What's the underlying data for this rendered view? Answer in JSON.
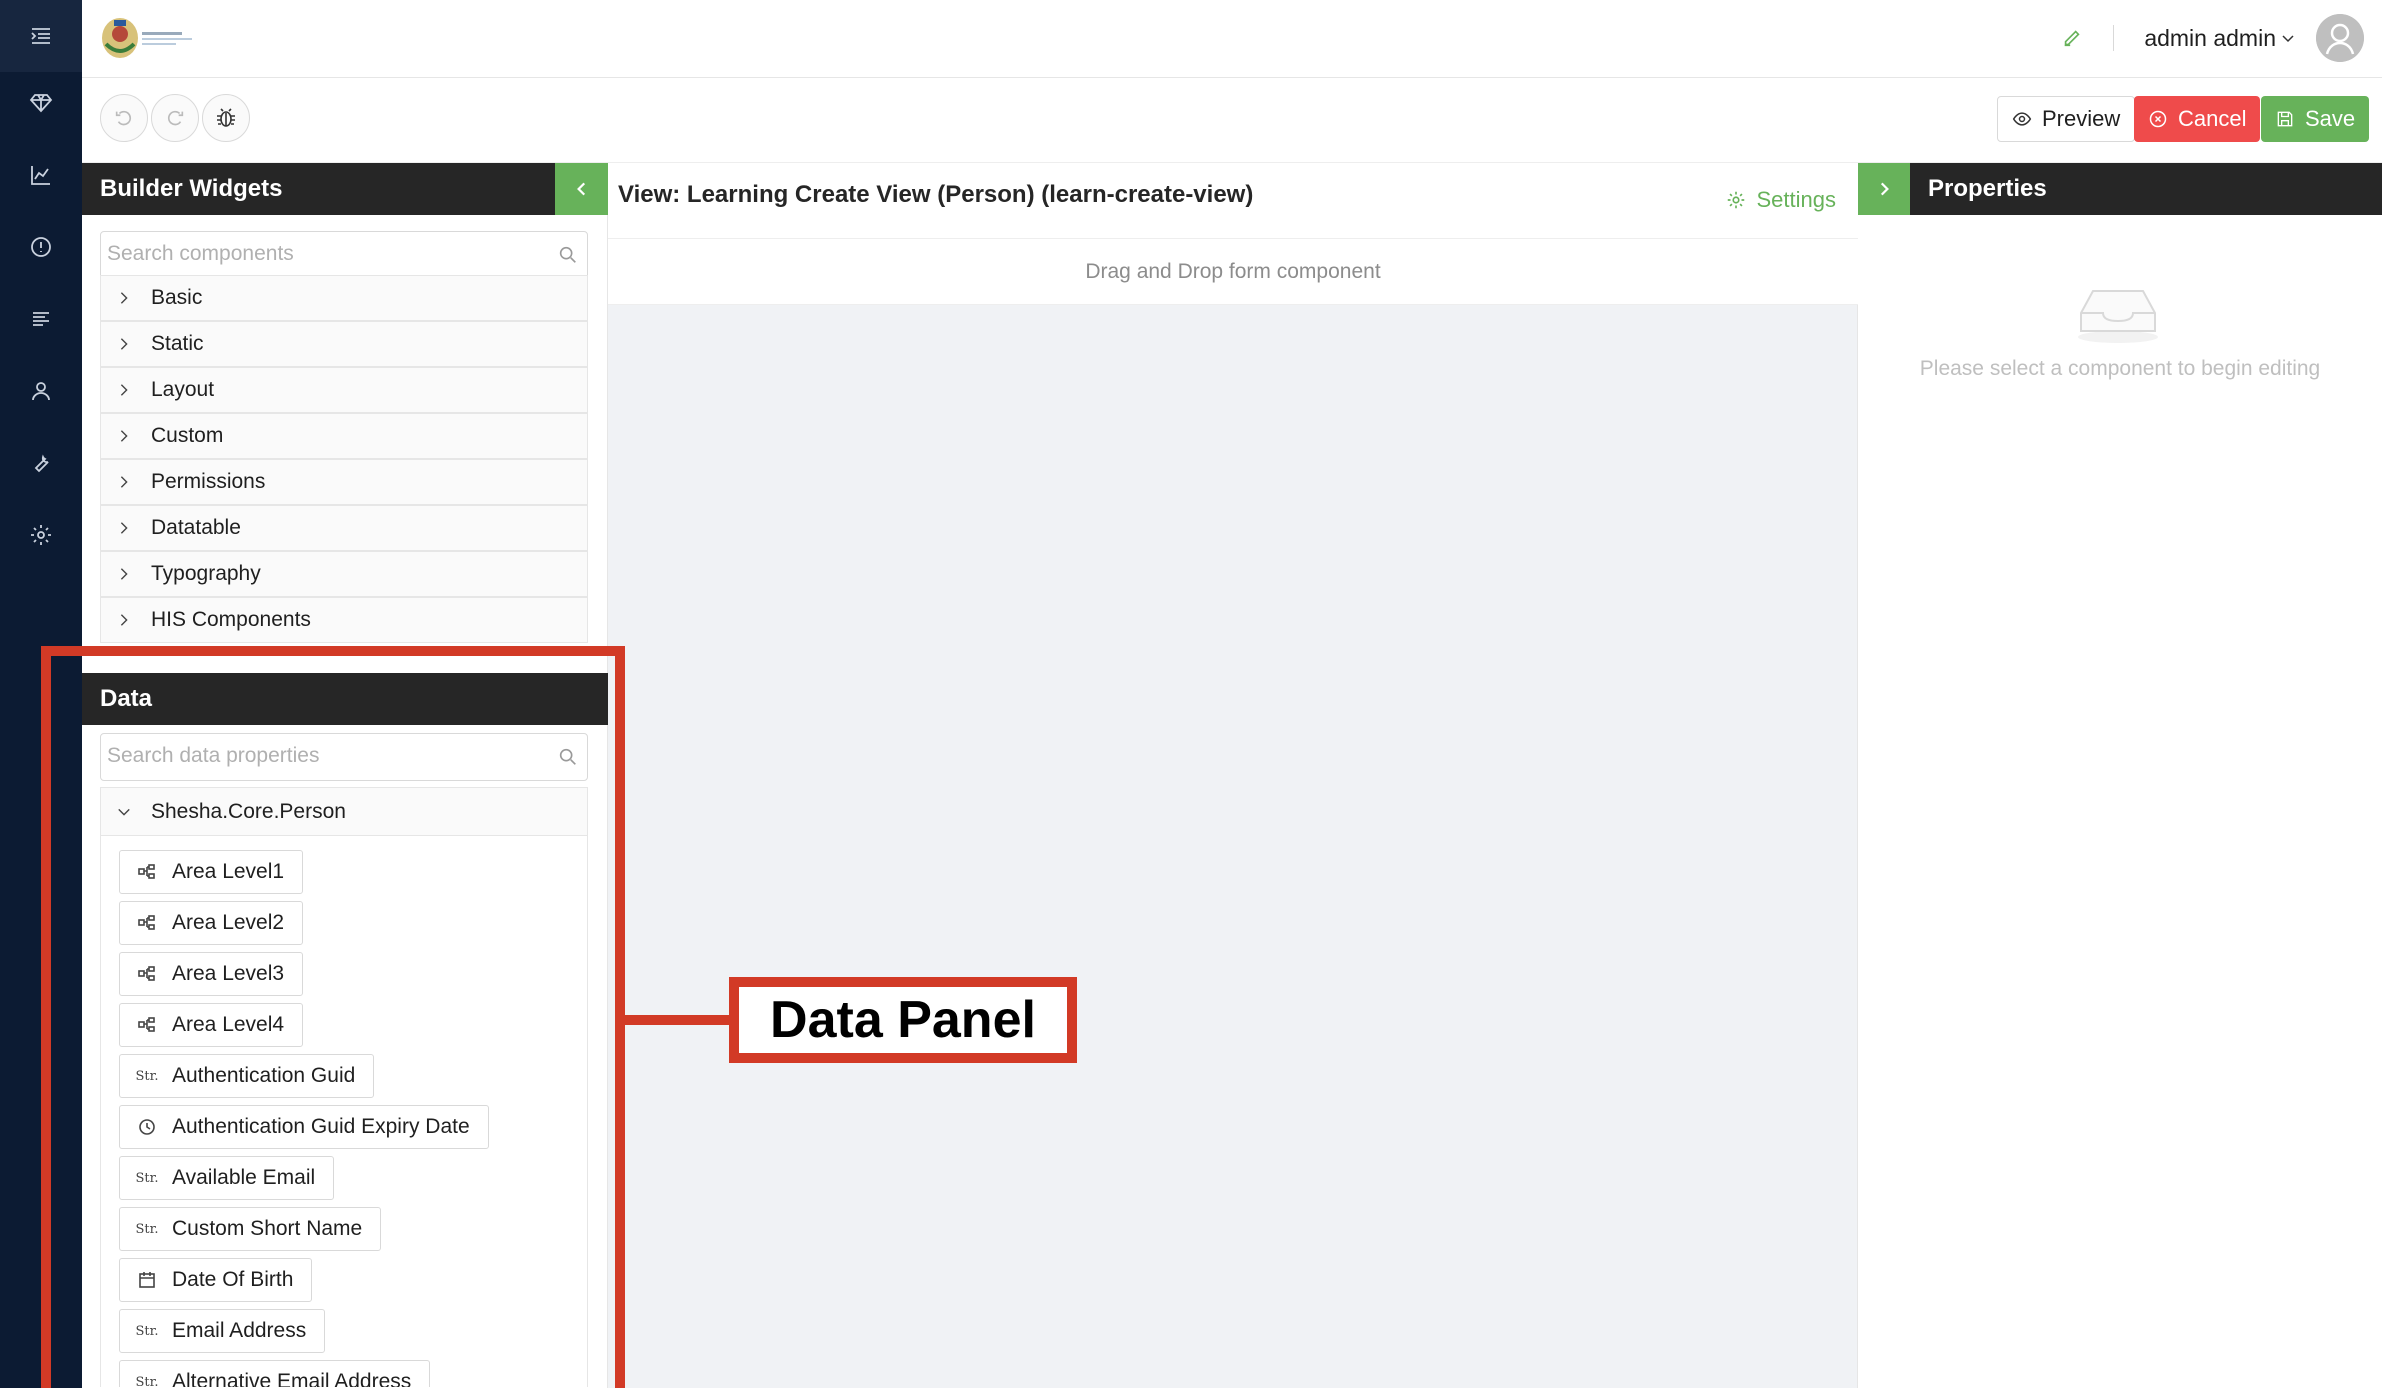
{
  "header": {
    "username": "admin admin"
  },
  "toolbar": {
    "preview_label": "Preview",
    "cancel_label": "Cancel",
    "save_label": "Save"
  },
  "widgets_panel": {
    "title": "Builder Widgets",
    "search_placeholder": "Search components",
    "categories": [
      "Basic",
      "Static",
      "Layout",
      "Custom",
      "Permissions",
      "Datatable",
      "Typography",
      "HIS Components"
    ]
  },
  "data_panel": {
    "title": "Data",
    "search_placeholder": "Search data properties",
    "entity": "Shesha.Core.Person",
    "properties": [
      {
        "label": "Area Level1",
        "icon": "reference-icon"
      },
      {
        "label": "Area Level2",
        "icon": "reference-icon"
      },
      {
        "label": "Area Level3",
        "icon": "reference-icon"
      },
      {
        "label": "Area Level4",
        "icon": "reference-icon"
      },
      {
        "label": "Authentication Guid",
        "icon": "string-icon"
      },
      {
        "label": "Authentication Guid Expiry Date",
        "icon": "datetime-icon"
      },
      {
        "label": "Available Email",
        "icon": "string-icon"
      },
      {
        "label": "Custom Short Name",
        "icon": "string-icon"
      },
      {
        "label": "Date Of Birth",
        "icon": "calendar-icon"
      },
      {
        "label": "Email Address",
        "icon": "string-icon"
      },
      {
        "label": "Alternative Email Address",
        "icon": "string-icon"
      }
    ],
    "string_icon_text": "Str."
  },
  "canvas": {
    "view_title": "View: Learning Create View (Person) (learn-create-view)",
    "settings_label": "Settings",
    "dropzone_text": "Drag and Drop form component"
  },
  "properties_panel": {
    "title": "Properties",
    "empty_text": "Please select a component to begin editing"
  },
  "annotation": {
    "label": "Data Panel",
    "color": "#d23a26"
  },
  "colors": {
    "accent_green": "#67b25a",
    "cancel_red": "#ef4b4b",
    "nav_dark": "#0c1b33",
    "panel_header": "#262626"
  }
}
